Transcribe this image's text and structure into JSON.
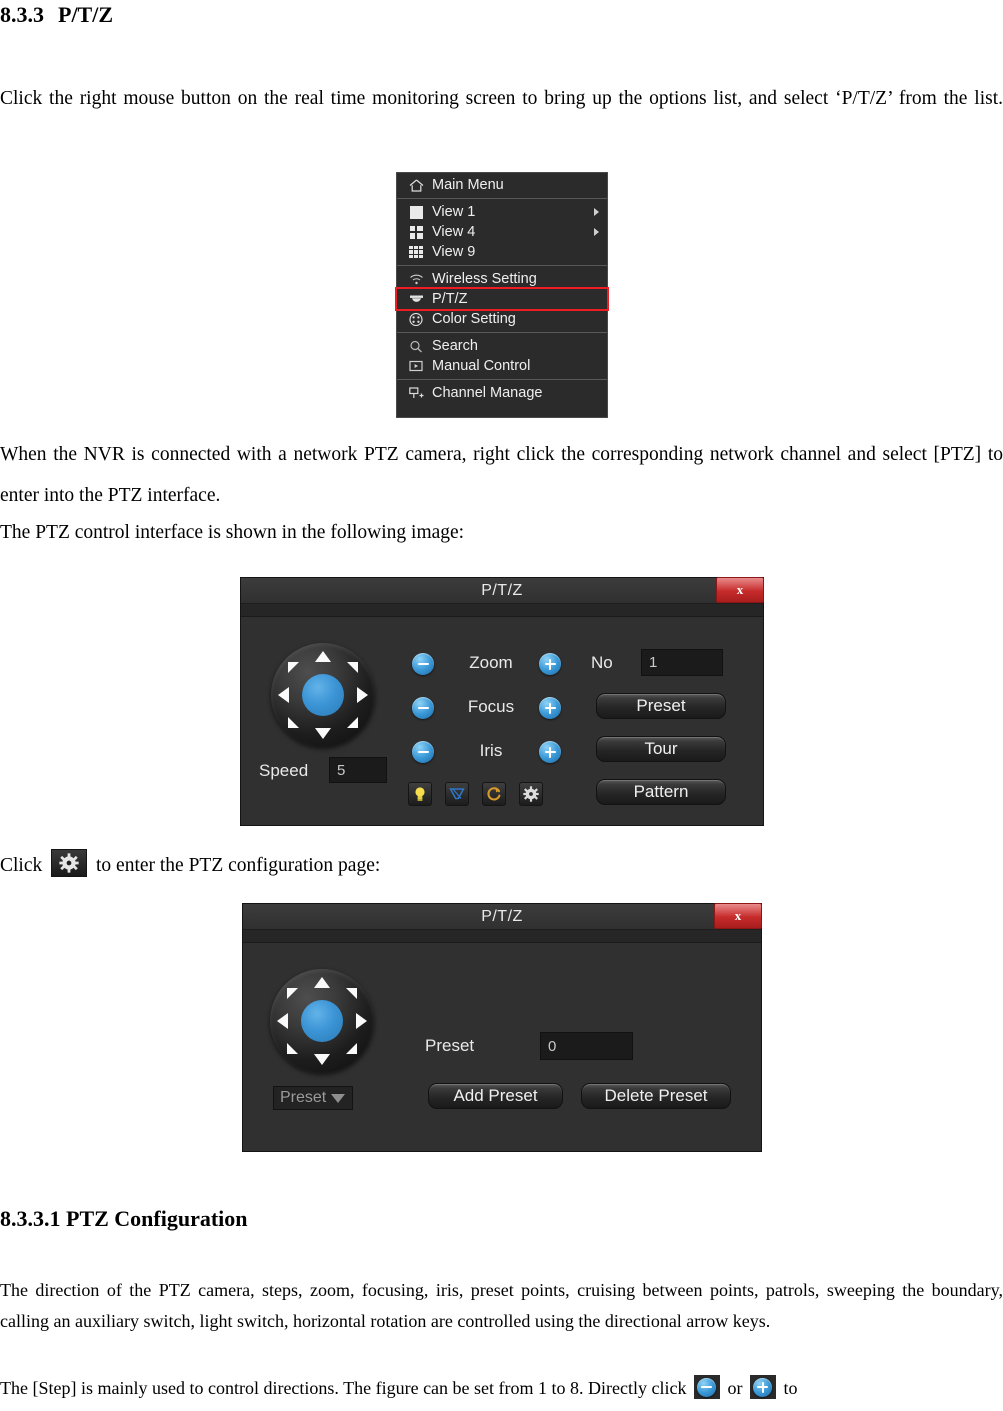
{
  "document": {
    "heading1": {
      "number": "8.3.3",
      "title": "P/T/Z"
    },
    "paragraph1": "Click the right mouse button on the real time monitoring screen to bring up the options list, and select ‘P/T/Z’ from the list.",
    "paragraph2": "When the NVR is connected with a network PTZ camera, right click the corresponding network channel and select [PTZ] to enter into the PTZ interface.",
    "paragraph3": "The PTZ control interface is shown in the following image:",
    "paragraph4_before_icon": "Click",
    "paragraph4_after_icon": "to enter the PTZ configuration page:",
    "heading2": "8.3.3.1 PTZ Configuration",
    "paragraph5": "The direction of the PTZ camera, steps, zoom, focusing, iris, preset points, cruising between points, patrols, sweeping the boundary, calling an auxiliary switch, light switch, horizontal rotation are controlled using the directional arrow keys.",
    "paragraph6_part1": "The [Step] is mainly used to control directions. The figure can be set from 1 to 8. Directly click",
    "paragraph6_or": "or",
    "paragraph6_part2": "to"
  },
  "context_menu": {
    "groups": [
      {
        "items": [
          {
            "label": "Main Menu",
            "icon": "home-icon",
            "submenu": false
          }
        ]
      },
      {
        "items": [
          {
            "label": "View 1",
            "icon": "view1-icon",
            "submenu": true
          },
          {
            "label": "View 4",
            "icon": "view4-icon",
            "submenu": true
          },
          {
            "label": "View 9",
            "icon": "view9-icon",
            "submenu": false
          }
        ]
      },
      {
        "items": [
          {
            "label": "Wireless Setting",
            "icon": "wifi-icon",
            "submenu": false
          },
          {
            "label": "P/T/Z",
            "icon": "ptz-dome-icon",
            "submenu": false,
            "highlighted": true
          },
          {
            "label": "Color Setting",
            "icon": "palette-icon",
            "submenu": false
          }
        ]
      },
      {
        "items": [
          {
            "label": "Search",
            "icon": "search-icon",
            "submenu": false
          },
          {
            "label": "Manual Control",
            "icon": "manual-control-icon",
            "submenu": false
          }
        ]
      },
      {
        "items": [
          {
            "label": "Channel Manage",
            "icon": "channel-manage-icon",
            "submenu": false
          }
        ]
      }
    ],
    "highlight_color": "#ee1c23"
  },
  "ptz_control_dialog": {
    "title": "P/T/Z",
    "close_label": "x",
    "joystick": {
      "directions": [
        "up",
        "up-right",
        "right",
        "down-right",
        "down",
        "down-left",
        "left",
        "up-left"
      ],
      "center": "hub-button"
    },
    "rows": [
      {
        "label": "Zoom",
        "minus": "−",
        "plus": "+"
      },
      {
        "label": "Focus",
        "minus": "−",
        "plus": "+"
      },
      {
        "label": "Iris",
        "minus": "−",
        "plus": "+"
      }
    ],
    "speed": {
      "label": "Speed",
      "value": "5"
    },
    "no_field": {
      "label": "No",
      "value": "1"
    },
    "buttons": [
      {
        "label": "Preset"
      },
      {
        "label": "Tour"
      },
      {
        "label": "Pattern"
      }
    ],
    "aux_icons": [
      {
        "name": "light-bulb-icon",
        "color": "#f2d23a"
      },
      {
        "name": "wiper-icon",
        "color": "#2f77c8"
      },
      {
        "name": "rotation-icon",
        "color": "#d79a2b"
      },
      {
        "name": "gear-icon",
        "color": "#dcdcdc"
      }
    ]
  },
  "ptz_config_dialog": {
    "title": "P/T/Z",
    "close_label": "x",
    "preset_label": "Preset",
    "preset_value": "0",
    "add_preset_label": "Add Preset",
    "delete_preset_label": "Delete Preset",
    "preset_dropdown": {
      "value": "Preset"
    }
  }
}
